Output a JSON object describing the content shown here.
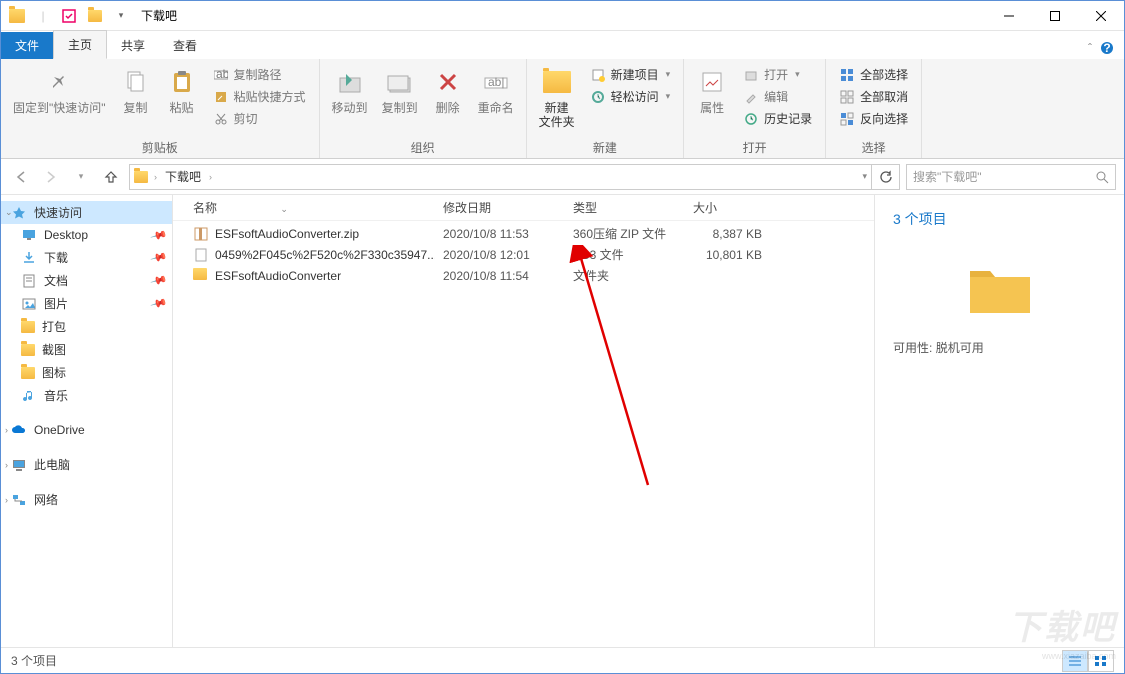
{
  "window": {
    "title": "下载吧"
  },
  "ribbon": {
    "tabs": {
      "file": "文件",
      "home": "主页",
      "share": "共享",
      "view": "查看"
    },
    "groups": {
      "clipboard": {
        "label": "剪贴板",
        "pin": "固定到\"快速访问\"",
        "copy": "复制",
        "paste": "粘贴",
        "copyPath": "复制路径",
        "pasteShortcut": "粘贴快捷方式",
        "cut": "剪切"
      },
      "organize": {
        "label": "组织",
        "moveTo": "移动到",
        "copyTo": "复制到",
        "delete": "删除",
        "rename": "重命名"
      },
      "new": {
        "label": "新建",
        "newFolder": "新建\n文件夹",
        "newItem": "新建项目",
        "easyAccess": "轻松访问"
      },
      "open": {
        "label": "打开",
        "properties": "属性",
        "open": "打开",
        "edit": "编辑",
        "history": "历史记录"
      },
      "select": {
        "label": "选择",
        "selectAll": "全部选择",
        "selectNone": "全部取消",
        "invertSelection": "反向选择"
      }
    }
  },
  "address": {
    "crumb": "下载吧"
  },
  "search": {
    "placeholder": "搜索\"下载吧\""
  },
  "sidebar": {
    "quickaccess": "快速访问",
    "desktop": "Desktop",
    "downloads": "下载",
    "documents": "文档",
    "pictures": "图片",
    "dabao": "打包",
    "jietu": "截图",
    "tubiao": "图标",
    "yinyue": "音乐",
    "onedrive": "OneDrive",
    "thispc": "此电脑",
    "network": "网络"
  },
  "columns": {
    "name": "名称",
    "date": "修改日期",
    "type": "类型",
    "size": "大小"
  },
  "files": [
    {
      "name": "ESFsoftAudioConverter.zip",
      "date": "2020/10/8 11:53",
      "type": "360压缩 ZIP 文件",
      "size": "8,387 KB",
      "icon": "zip"
    },
    {
      "name": "0459%2F045c%2F520c%2F330c35947...",
      "date": "2020/10/8 12:01",
      "type": "AC3 文件",
      "size": "10,801 KB",
      "icon": "file"
    },
    {
      "name": "ESFsoftAudioConverter",
      "date": "2020/10/8 11:54",
      "type": "文件夹",
      "size": "",
      "icon": "folder"
    }
  ],
  "details": {
    "title": "3 个项目",
    "availability_label": "可用性:",
    "availability_value": "脱机可用"
  },
  "status": {
    "count": "3 个项目"
  },
  "watermark": {
    "main": "下载吧",
    "sub": "www.xiazaiba.com"
  }
}
